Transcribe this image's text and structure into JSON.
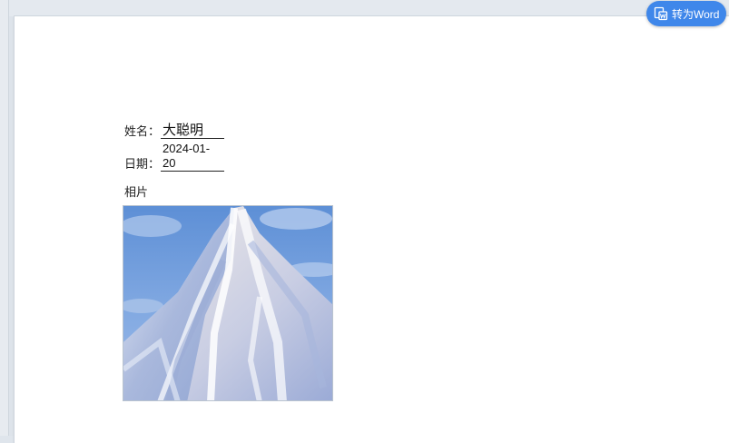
{
  "toolbar": {
    "convert_label": "转为Word",
    "convert_icon": "word-convert-icon",
    "accent": "#3f87ea"
  },
  "document": {
    "name_label": "姓名：",
    "name_value": "大聪明",
    "date_label": "日期：",
    "date_value": "2024-01-20",
    "photo_label": "相片",
    "photo_subject": "snow-mountain-painting"
  }
}
